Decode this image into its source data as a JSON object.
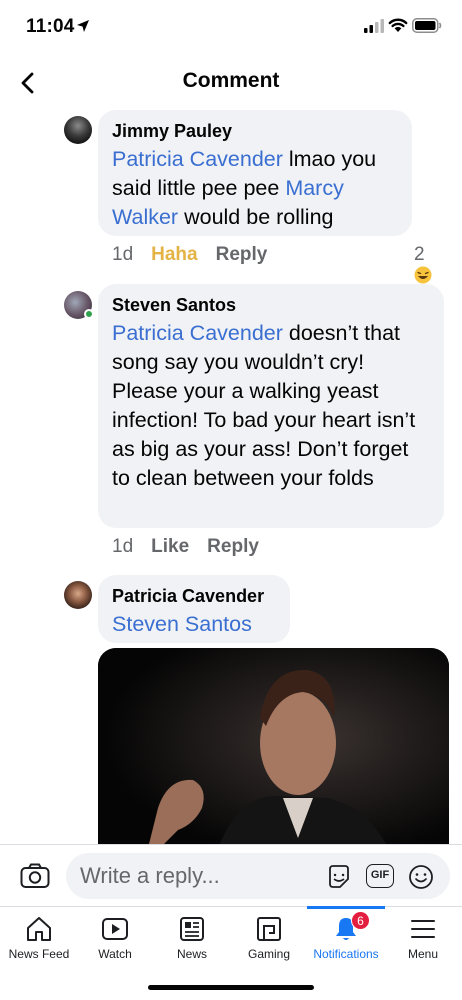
{
  "status_bar": {
    "time": "11:04"
  },
  "header": {
    "title": "Comment"
  },
  "comments": [
    {
      "author": "Jimmy Pauley",
      "mention1": "Patricia Cavender",
      "text1": " lmao you said little pee pee ",
      "mention2": "Marcy Walker",
      "text2": " would be rolling",
      "time": "1d",
      "reaction": "Haha",
      "reply": "Reply",
      "reaction_count": "2"
    },
    {
      "author": "Steven Santos",
      "mention1": "Patricia Cavender",
      "text1": " doesn’t that song say you wouldn’t cry! Please your a walking yeast infection! To bad your heart isn’t as big as your ass! Don’t forget to clean between your folds",
      "time": "1d",
      "like": "Like",
      "reply": "Reply"
    },
    {
      "author": "Patricia Cavender",
      "mention1": "Steven Santos"
    }
  ],
  "reply_bar": {
    "placeholder": "Write a reply...",
    "gif_label": "GIF"
  },
  "tabs": [
    {
      "label": "News Feed",
      "icon": "home-icon"
    },
    {
      "label": "Watch",
      "icon": "video-icon"
    },
    {
      "label": "News",
      "icon": "newspaper-icon"
    },
    {
      "label": "Gaming",
      "icon": "gaming-icon"
    },
    {
      "label": "Notifications",
      "icon": "bell-icon",
      "badge": "6",
      "active": true
    },
    {
      "label": "Menu",
      "icon": "menu-icon"
    }
  ],
  "colors": {
    "mention": "#3a6fd1",
    "accent": "#1877f2",
    "haha": "#e4b345",
    "badge": "#e41e3f",
    "bubble": "#f0f2f5"
  }
}
